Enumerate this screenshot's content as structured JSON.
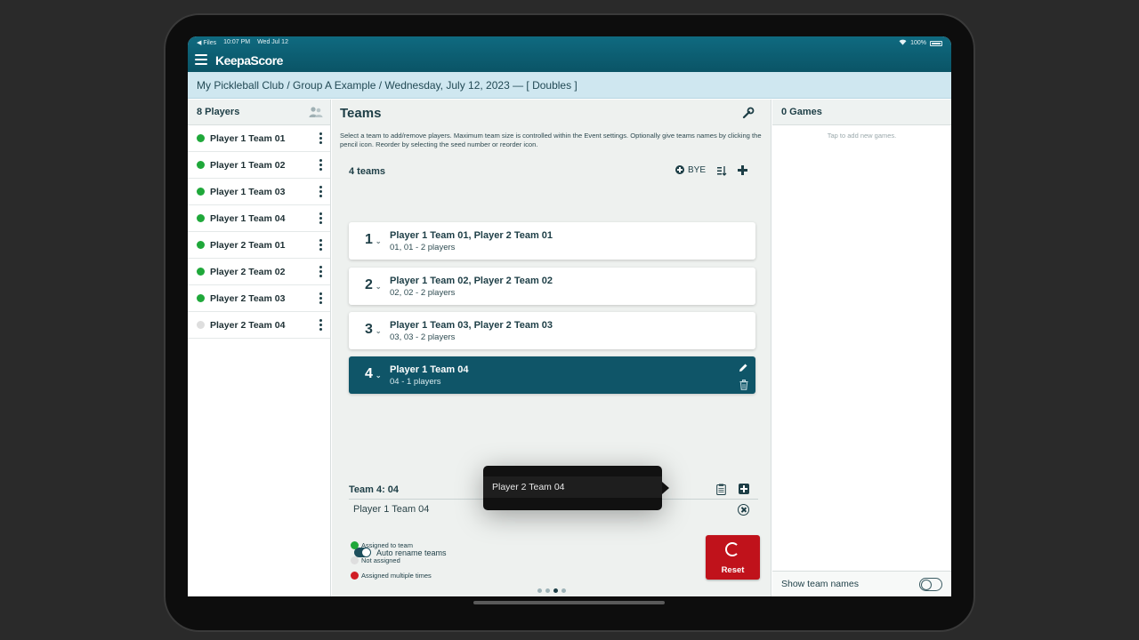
{
  "status_bar": {
    "back_app": "◀ Files",
    "time": "10:07 PM",
    "date": "Wed Jul 12",
    "wifi": "📶",
    "battery": "100%"
  },
  "app": {
    "logo": "KeepaScore"
  },
  "breadcrumb": "My Pickleball Club / Group A Example / Wednesday, July 12, 2023 — [ Doubles ]",
  "players": {
    "title": "8 Players",
    "items": [
      {
        "label": "Player 1 Team 01",
        "status": "assigned",
        "color": "#1fa83a"
      },
      {
        "label": "Player 1 Team 02",
        "status": "assigned",
        "color": "#1fa83a"
      },
      {
        "label": "Player 1 Team 03",
        "status": "assigned",
        "color": "#1fa83a"
      },
      {
        "label": "Player 1 Team 04",
        "status": "assigned",
        "color": "#1fa83a"
      },
      {
        "label": "Player 2 Team 01",
        "status": "assigned",
        "color": "#1fa83a"
      },
      {
        "label": "Player 2 Team 02",
        "status": "assigned",
        "color": "#1fa83a"
      },
      {
        "label": "Player 2 Team 03",
        "status": "assigned",
        "color": "#1fa83a"
      },
      {
        "label": "Player 2 Team 04",
        "status": "not-assigned",
        "color": "#dedede"
      }
    ]
  },
  "teams": {
    "title": "Teams",
    "description": "Select a team to add/remove players. Maximum team size is controlled within the Event settings. Optionally give teams names by clicking the pencil icon. Reorder by selecting the seed number or reorder icon.",
    "count_label": "4 teams",
    "bye_label": "BYE",
    "list": [
      {
        "seed": "1",
        "name": "Player 1 Team 01, Player 2 Team 01",
        "sub": "01, 01 - 2 players"
      },
      {
        "seed": "2",
        "name": "Player 1 Team 02, Player 2 Team 02",
        "sub": "02, 02 - 2 players"
      },
      {
        "seed": "3",
        "name": "Player 1 Team 03, Player 2 Team 03",
        "sub": "03, 03 - 2 players"
      },
      {
        "seed": "4",
        "name": "Player 1 Team 04",
        "sub": "04 - 1 players"
      }
    ],
    "chevron": "⌄",
    "selected_detail": {
      "title": "Team 4: 04",
      "member": "Player 1 Team 04"
    },
    "tooltip_option": "Player 2 Team 04",
    "auto_rename_label": "Auto rename teams",
    "legend": [
      {
        "label": "Assigned to team",
        "color": "#1fa83a"
      },
      {
        "label": "Not assigned",
        "color": "#dedede"
      },
      {
        "label": "Assigned multiple times",
        "color": "#d01d24"
      }
    ],
    "reset_label": "Reset"
  },
  "games": {
    "title": "0 Games",
    "hint": "Tap to add new games.",
    "show_team_names_label": "Show team names"
  }
}
